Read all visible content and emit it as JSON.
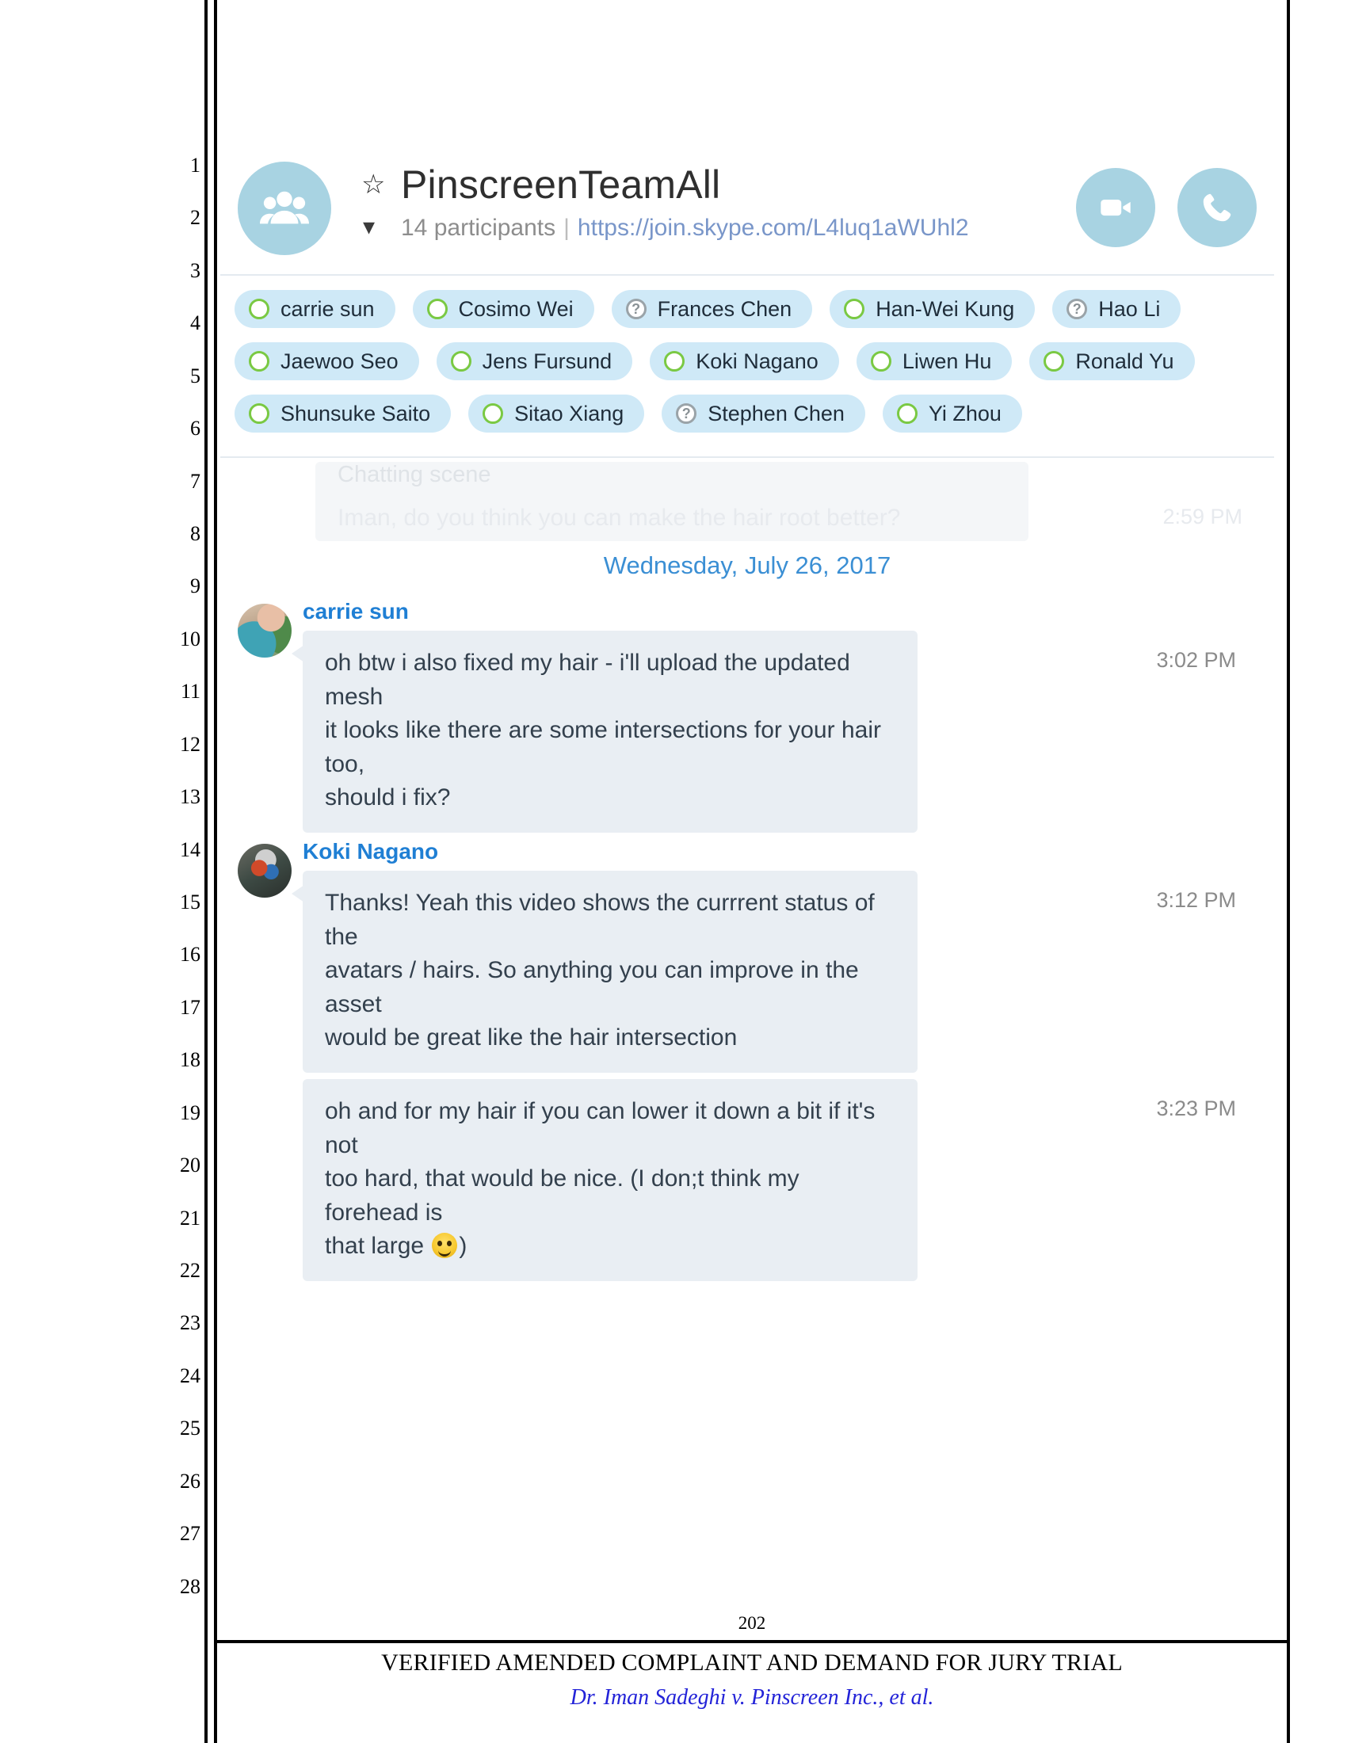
{
  "pleading": {
    "line_numbers": [
      "1",
      "2",
      "3",
      "4",
      "5",
      "6",
      "7",
      "8",
      "9",
      "10",
      "11",
      "12",
      "13",
      "14",
      "15",
      "16",
      "17",
      "18",
      "19",
      "20",
      "21",
      "22",
      "23",
      "24",
      "25",
      "26",
      "27",
      "28"
    ],
    "page_number": "202",
    "footer_title": "VERIFIED AMENDED COMPLAINT AND DEMAND FOR JURY TRIAL",
    "footer_caption": "Dr. Iman Sadeghi v. Pinscreen Inc., et al."
  },
  "skype": {
    "header": {
      "group_avatar_icon": "people-icon",
      "favorite_icon": "star-icon",
      "title": "PinscreenTeamAll",
      "expand_icon": "chevron-down-icon",
      "participants_count": "14 participants",
      "separator": "|",
      "join_url": "https://join.skype.com/L4luq1aWUhl2",
      "video_call_icon": "video-camera-icon",
      "voice_call_icon": "phone-icon"
    },
    "participant_rows": [
      [
        {
          "name": "carrie sun",
          "status": "online"
        },
        {
          "name": "Cosimo Wei",
          "status": "online"
        },
        {
          "name": "Frances Chen",
          "status": "unknown"
        },
        {
          "name": "Han-Wei Kung",
          "status": "online"
        },
        {
          "name": "Hao Li",
          "status": "unknown"
        }
      ],
      [
        {
          "name": "Jaewoo Seo",
          "status": "online"
        },
        {
          "name": "Jens Fursund",
          "status": "online"
        },
        {
          "name": "Koki Nagano",
          "status": "online"
        },
        {
          "name": "Liwen Hu",
          "status": "online"
        },
        {
          "name": "Ronald Yu",
          "status": "online"
        }
      ],
      [
        {
          "name": "Shunsuke Saito",
          "status": "online"
        },
        {
          "name": "Sitao Xiang",
          "status": "online"
        },
        {
          "name": "Stephen Chen",
          "status": "unknown"
        },
        {
          "name": "Yi Zhou",
          "status": "online"
        }
      ]
    ],
    "faded_previous": {
      "title": "Chatting scene",
      "text": "Iman, do you think you can make the hair root better?",
      "time": "2:59 PM"
    },
    "date_divider": "Wednesday, July 26, 2017",
    "conversation": [
      {
        "sender": "carrie sun",
        "avatar": "carrie-sun-avatar",
        "messages": [
          {
            "lines": [
              "oh btw i also fixed my hair - i'll upload the updated mesh",
              "it looks like there are some intersections for your hair too,",
              "should i fix?"
            ],
            "time": "3:02 PM",
            "has_tail": true,
            "has_emoji": false
          }
        ]
      },
      {
        "sender": "Koki Nagano",
        "avatar": "koki-nagano-avatar",
        "messages": [
          {
            "lines": [
              "Thanks! Yeah this video shows the currrent status of the",
              "avatars / hairs. So anything you can improve in the asset",
              "would be great like the hair intersection"
            ],
            "time": "3:12 PM",
            "has_tail": true,
            "has_emoji": false
          },
          {
            "lines": [
              "oh and for my hair if you can lower it down a bit if it's not",
              "too hard, that would be nice. (I don;t think my forehead is",
              "that large "
            ],
            "trailing": ")",
            "time": "3:23 PM",
            "has_tail": false,
            "has_emoji": true,
            "emoji_name": "smiley-face-emoji"
          }
        ]
      }
    ]
  },
  "colors": {
    "chip_bg": "#cfe9f7",
    "status_online": "#7ac943",
    "status_unknown": "#9aa3a8",
    "bubble_bg": "#e9eef3",
    "sender_blue": "#1f7fd4",
    "date_blue": "#3b8fd4",
    "avatar_bg": "#a8d3e2",
    "caption_blue": "#2323d8"
  }
}
